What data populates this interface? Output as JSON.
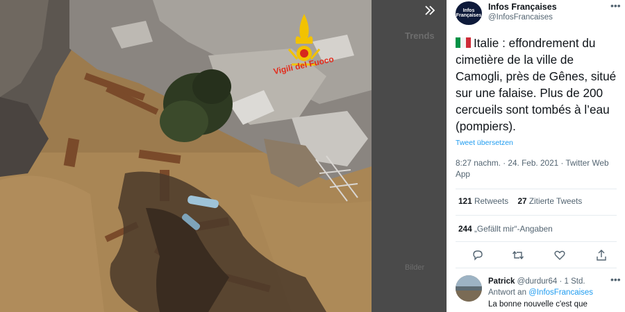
{
  "viewer": {
    "expand_icon": "chevron-double-right-icon",
    "watermark_text": "Vigili del Fuoco",
    "background_ghost_text": [
      "Trends",
      "Bilder"
    ]
  },
  "tweet": {
    "author_name": "Infos Françaises",
    "author_handle": "@InfosFrancaises",
    "avatar_text": "Infos Françaises",
    "text": "Italie : effondrement du cimetière de la ville de Camogli, près de Gênes, situé sur une falaise. Plus de 200 cercueils sont tombés à l’eau (pompiers).",
    "translate_label": "Tweet übersetzen",
    "timestamp": "8:27 nachm. · 24. Feb. 2021 · Twitter Web App",
    "retweets_count": "121",
    "retweets_label": "Retweets",
    "quotes_count": "27",
    "quotes_label": "Zitierte Tweets",
    "likes_count": "244",
    "likes_label": "„Gefällt mir“-Angaben",
    "more_label": "•••",
    "flag_colors": [
      "#009246",
      "#ffffff",
      "#ce2b37"
    ]
  },
  "actions": {
    "icons": [
      "reply-icon",
      "retweet-icon",
      "like-icon",
      "share-icon"
    ]
  },
  "reply": {
    "author_name": "Patrick",
    "author_handle": "@durdur64 · 1 Std.",
    "reply_to_prefix": "Antwort an",
    "reply_to_handle": "@InfosFrancaises",
    "text": "La bonne nouvelle c'est que",
    "more_label": "•••"
  },
  "colors": {
    "accent": "#1d9bf0",
    "text_primary": "#0f1419",
    "text_secondary": "#536471"
  }
}
